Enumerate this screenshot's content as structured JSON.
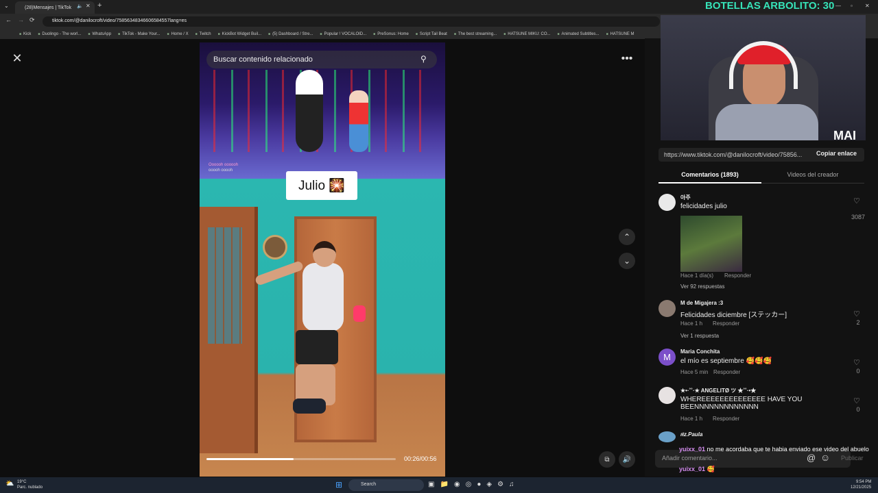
{
  "browser": {
    "tab_title": "(28)Mensajes | TikTok",
    "url": "tiktok.com/@danilocroft/video/75856348346606584557lang=es",
    "bookmarks": [
      "Kick",
      "Duolingo - The worl...",
      "WhatsApp",
      "TikTok - Make Your...",
      "Home / X",
      "Twitch",
      "KickBot Widget Buil...",
      "(5) Dashboard / Stre...",
      "Popular ! VOCALOID...",
      "PreSonus: Home",
      "Script Tail Beat",
      "The best streaming...",
      "HATSUNE MIKU: CO...",
      "Animated Subtitles...",
      "HATSUNE M"
    ]
  },
  "overlay": {
    "botellas": "BOTELLAS ARBOLITO: 30",
    "cam_tag": "MAI"
  },
  "video": {
    "search_placeholder": "Buscar contenido relacionado",
    "label": "Julio 🎇",
    "game_text1": "Oooooh oooooh",
    "game_text2": "ooooh ooooh",
    "time": "00:26/00:56",
    "progress": 0.46
  },
  "panel": {
    "share_url": "https://www.tiktok.com/@danilocroft/video/75856...",
    "copy_label": "Copiar enlace",
    "tab_comments": "Comentarios (1893)",
    "tab_creator": "Videos del creador",
    "add_comment_placeholder": "Añadir comentario...",
    "publish": "Publicar"
  },
  "comments": [
    {
      "name": "아주",
      "text": "felicidades julio",
      "time": "Hace 1 día(s)",
      "reply": "Responder",
      "likes": "3087",
      "more": "Ver 92 respuestas"
    },
    {
      "name": "M de Migajera :3",
      "text": "Felicidades diciembre [ステッカー]",
      "time": "Hace 1 h",
      "reply": "Responder",
      "likes": "2",
      "more": "Ver 1 respuesta"
    },
    {
      "name": "Maria Conchita",
      "text": "el mío es septiembre 🥰🥰🥰",
      "time": "Hace 5 min",
      "reply": "Responder",
      "likes": "0",
      "avatar": "M"
    },
    {
      "name": "★•·˚˚·★ ANGELITØ ツ ★˚˚·•★",
      "text": "WHEREEEEEEEEEEEEEE HAVE YOU BEENNNNNNNNNNNNN",
      "time": "Hace 1 h",
      "reply": "Responder",
      "likes": "0"
    },
    {
      "name": "ıŧz.Paula"
    }
  ],
  "chat": [
    {
      "user": "yuixx_01",
      "msg": "no me acordaba que te habia enviado ese video del abuelo"
    },
    {
      "user": "yuixx_01",
      "msg": "🥰"
    }
  ],
  "taskbar": {
    "weather_temp": "19°C",
    "weather_desc": "Parc. nublado",
    "search": "Search",
    "clock_time": "9:54 PM",
    "clock_date": "12/21/2025"
  }
}
